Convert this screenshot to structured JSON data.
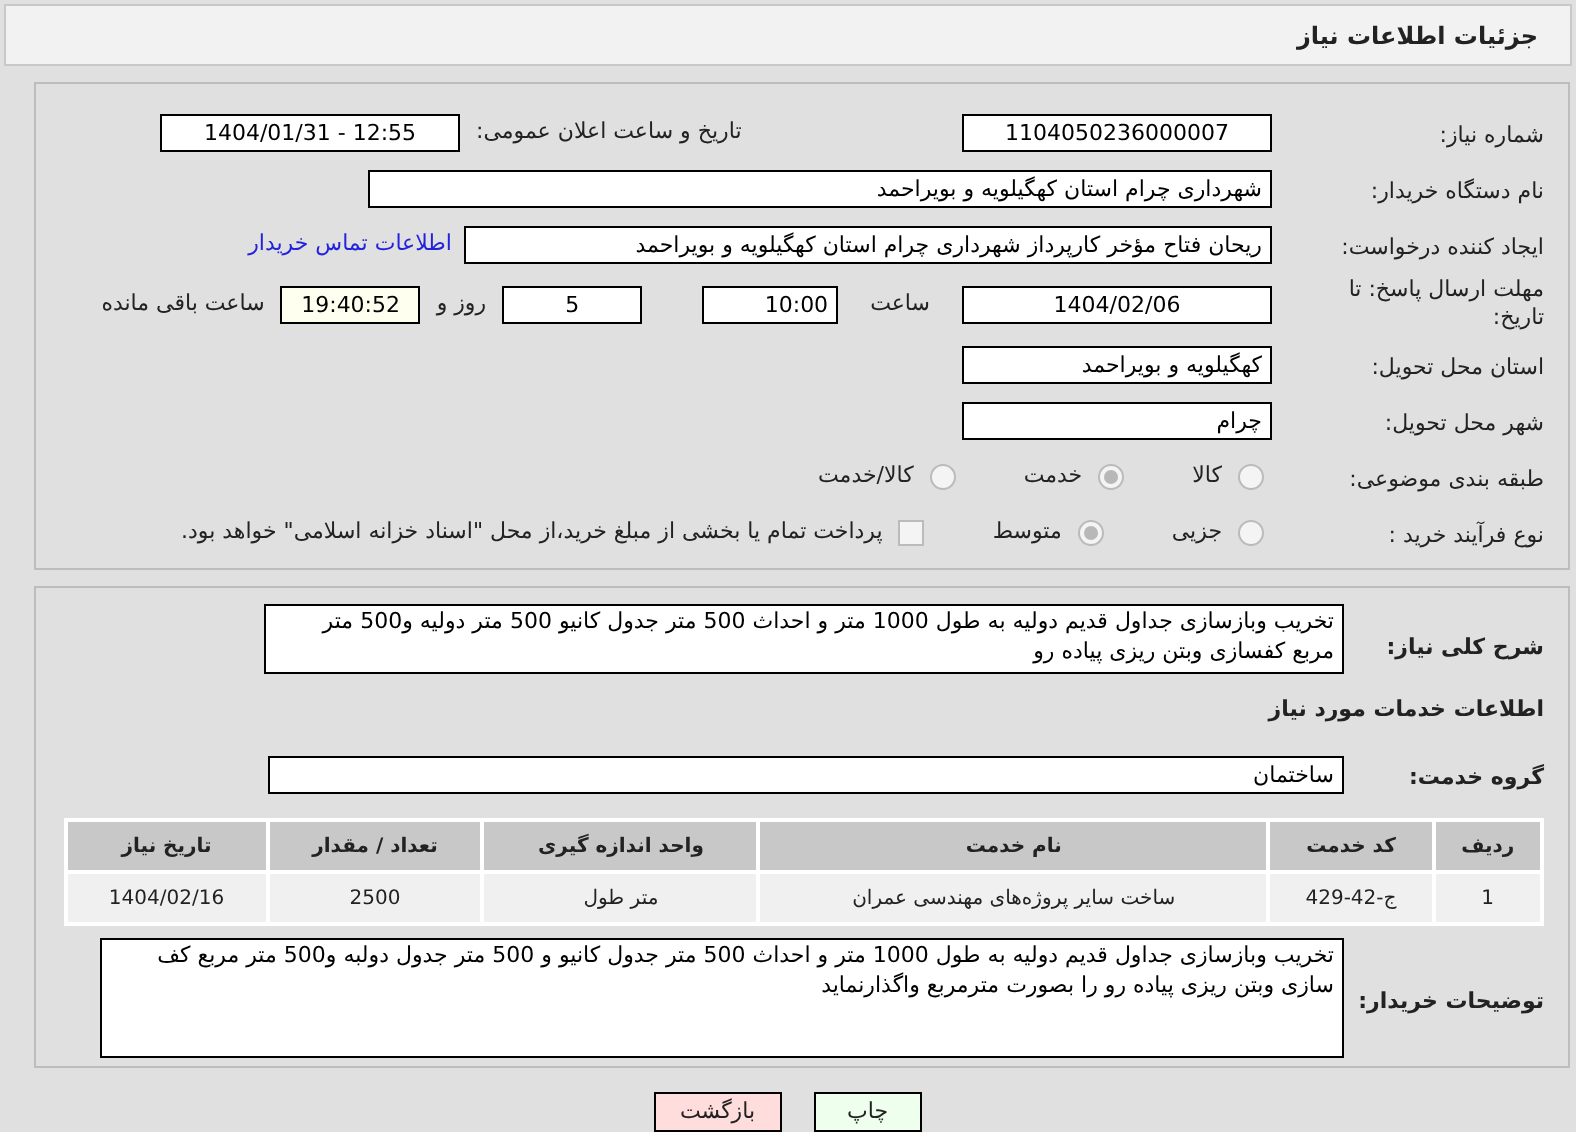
{
  "header": {
    "title": "جزئیات اطلاعات نیاز"
  },
  "need_number": {
    "label": "شماره نیاز:",
    "value": "1104050236000007"
  },
  "announce": {
    "label": "تاریخ و ساعت اعلان عمومی:",
    "value": "1404/01/31 - 12:55"
  },
  "buyer_org": {
    "label": "نام دستگاه خریدار:",
    "value": "شهرداری چرام استان کهگیلویه و بویراحمد"
  },
  "creator": {
    "label": "ایجاد کننده درخواست:",
    "value": "ریحان فتاح مؤخر کارپرداز شهرداری چرام استان کهگیلویه و بویراحمد",
    "link": "اطلاعات تماس خریدار"
  },
  "deadline": {
    "label": "مهلت ارسال پاسخ: تا تاریخ:",
    "date": "1404/02/06",
    "time_label": "ساعت",
    "time": "10:00",
    "days": "5",
    "days_label": "روز و",
    "remaining": "19:40:52",
    "remaining_label": "ساعت باقی مانده"
  },
  "province": {
    "label": "استان محل تحویل:",
    "value": "کهگیلویه و بویراحمد"
  },
  "city": {
    "label": "شهر محل تحویل:",
    "value": "چرام"
  },
  "category": {
    "label": "طبقه بندی موضوعی:",
    "options": [
      {
        "label": "کالا",
        "selected": false
      },
      {
        "label": "خدمت",
        "selected": true
      },
      {
        "label": "کالا/خدمت",
        "selected": false
      }
    ]
  },
  "process": {
    "label": "نوع فرآیند خرید :",
    "options": [
      {
        "label": "جزیی",
        "selected": false
      },
      {
        "label": "متوسط",
        "selected": true
      }
    ],
    "treasury": {
      "label": "پرداخت تمام یا بخشی از مبلغ خرید،از محل \"اسناد خزانه اسلامی\" خواهد بود.",
      "checked": false
    }
  },
  "description": {
    "label": "شرح کلی نیاز:",
    "value": "تخریب وبازسازی جداول قدیم دولیه به طول 1000 متر  و احداث 500 متر جدول کانیو 500 متر دولیه  و500 متر مربع کفسازی وبتن ریزی پیاده رو"
  },
  "services_heading": "اطلاعات خدمات مورد نیاز",
  "service_group": {
    "label": "گروه خدمت:",
    "value": "ساختمان"
  },
  "table": {
    "columns": [
      "ردیف",
      "کد خدمت",
      "نام خدمت",
      "واحد اندازه گیری",
      "تعداد / مقدار",
      "تاریخ نیاز"
    ],
    "rows": [
      [
        "1",
        "ج-42-429",
        "ساخت سایر پروژه‌های مهندسی عمران",
        "متر طول",
        "2500",
        "1404/02/16"
      ]
    ]
  },
  "buyer_notes": {
    "label": "توضیحات خریدار:",
    "value": "تخریب وبازسازی جداول قدیم دولیه به طول 1000 متر  و احداث 500 متر جدول کانیو و 500 متر جدول دولبه  و500 متر مربع کف سازی وبتن ریزی پیاده رو را بصورت مترمربع واگذارنماید"
  },
  "buttons": [
    {
      "kind": "print",
      "label": "چاپ"
    },
    {
      "kind": "back",
      "label": "بازگشت"
    }
  ]
}
